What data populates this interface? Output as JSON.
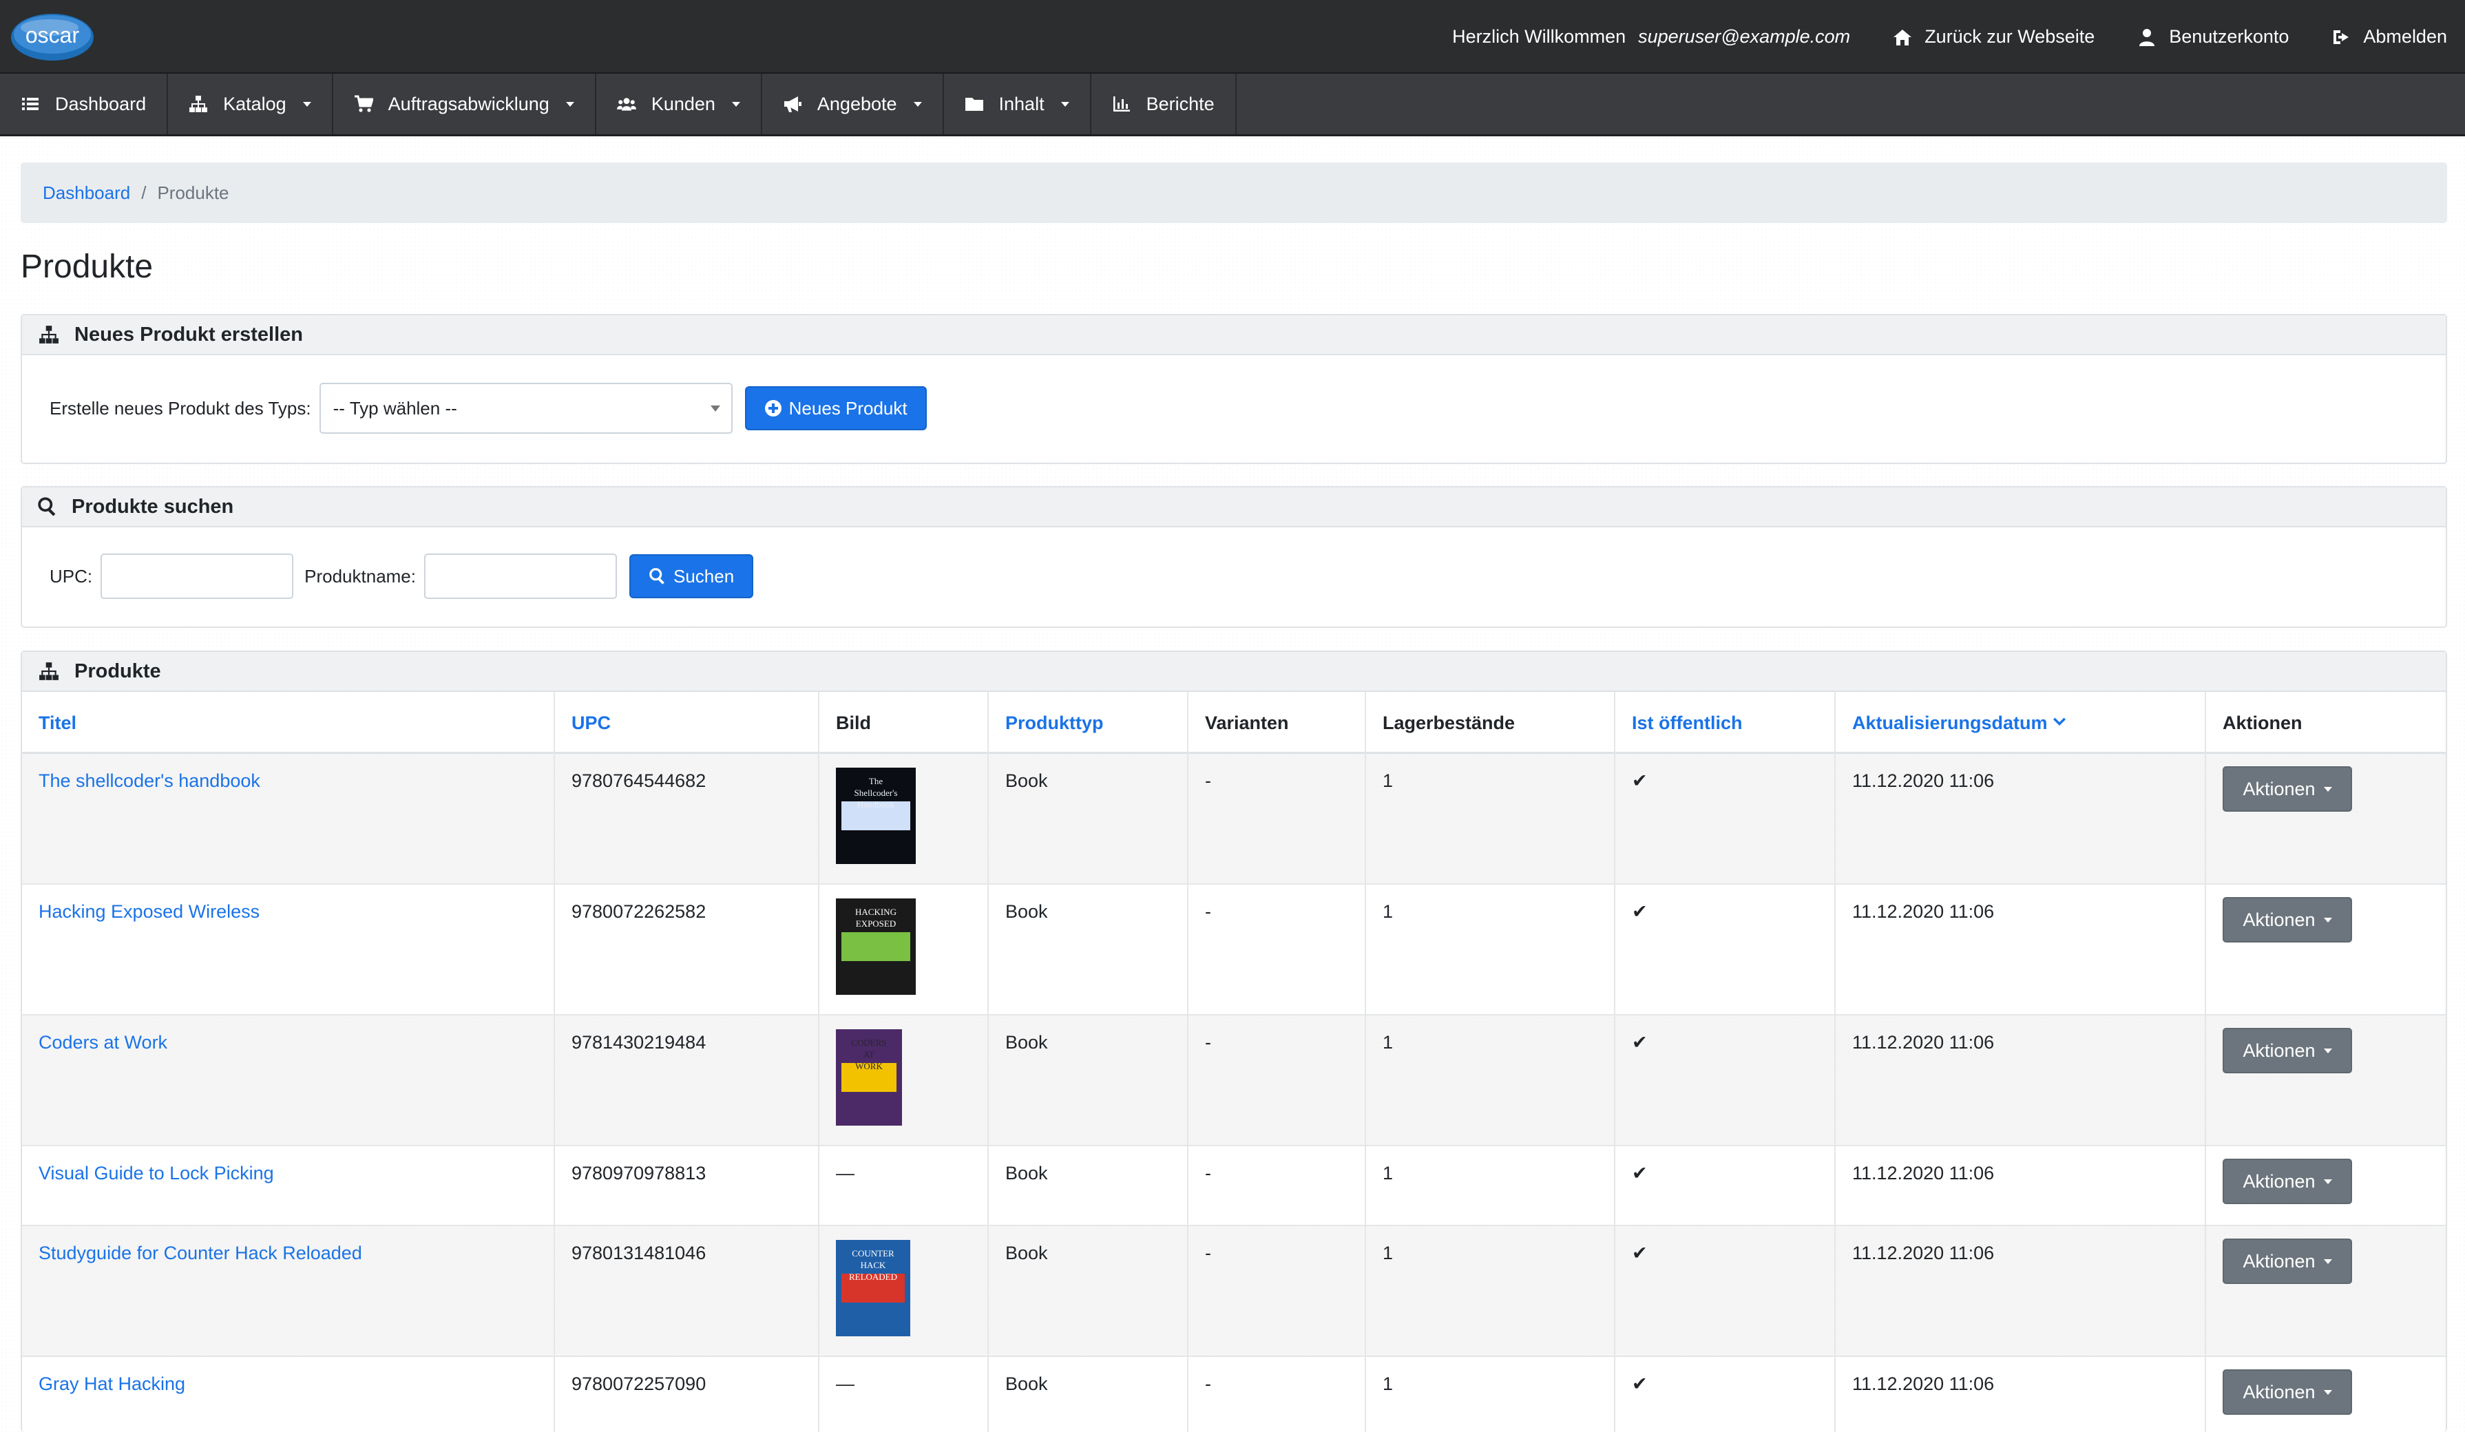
{
  "topbar": {
    "logo_text": "oscar",
    "welcome_prefix": "Herzlich Willkommen",
    "welcome_user": "superuser@example.com",
    "back_label": "Zurück zur Webseite",
    "account_label": "Benutzerkonto",
    "logout_label": "Abmelden"
  },
  "nav": {
    "dashboard": "Dashboard",
    "katalog": "Katalog",
    "auftrag": "Auftragsabwicklung",
    "kunden": "Kunden",
    "angebote": "Angebote",
    "inhalt": "Inhalt",
    "berichte": "Berichte"
  },
  "breadcrumb": {
    "home": "Dashboard",
    "separator": "/",
    "current": "Produkte"
  },
  "page_title": "Produkte",
  "create_panel": {
    "title": "Neues Produkt erstellen",
    "label": "Erstelle neues Produkt des Typs:",
    "select_value": "-- Typ wählen --",
    "button": "Neues Produkt"
  },
  "search_panel": {
    "title": "Produkte suchen",
    "upc_label": "UPC:",
    "name_label": "Produktname:",
    "button": "Suchen"
  },
  "table_panel": {
    "title": "Produkte",
    "headers": {
      "titel": "Titel",
      "upc": "UPC",
      "bild": "Bild",
      "produkttyp": "Produkttyp",
      "varianten": "Varianten",
      "lager": "Lagerbestände",
      "oeffentlich": "Ist öffentlich",
      "datum": "Aktualisierungsdatum",
      "aktionen": "Aktionen"
    },
    "rows": [
      {
        "title": "The shellcoder's handbook",
        "upc": "9780764544682",
        "image": "cover",
        "cover_text": "The Shellcoder's Handbook",
        "type": "Book",
        "variants": "-",
        "stock": "1",
        "public": "✔",
        "updated": "11.12.2020 11:06",
        "action": "Aktionen"
      },
      {
        "title": "Hacking Exposed Wireless",
        "upc": "9780072262582",
        "image": "cover",
        "cover_text": "HACKING EXPOSED",
        "type": "Book",
        "variants": "-",
        "stock": "1",
        "public": "✔",
        "updated": "11.12.2020 11:06",
        "action": "Aktionen"
      },
      {
        "title": "Coders at Work",
        "upc": "9781430219484",
        "image": "cover",
        "cover_text": "CODERS AT WORK",
        "type": "Book",
        "variants": "-",
        "stock": "1",
        "public": "✔",
        "updated": "11.12.2020 11:06",
        "action": "Aktionen"
      },
      {
        "title": "Visual Guide to Lock Picking",
        "upc": "9780970978813",
        "image": "—",
        "type": "Book",
        "variants": "-",
        "stock": "1",
        "public": "✔",
        "updated": "11.12.2020 11:06",
        "action": "Aktionen"
      },
      {
        "title": "Studyguide for Counter Hack Reloaded",
        "upc": "9780131481046",
        "image": "cover",
        "cover_text": "COUNTER HACK RELOADED",
        "type": "Book",
        "variants": "-",
        "stock": "1",
        "public": "✔",
        "updated": "11.12.2020 11:06",
        "action": "Aktionen"
      },
      {
        "title": "Gray Hat Hacking",
        "upc": "9780072257090",
        "image": "—",
        "type": "Book",
        "variants": "-",
        "stock": "1",
        "public": "✔",
        "updated": "11.12.2020 11:06",
        "action": "Aktionen"
      }
    ]
  },
  "colors": {
    "link": "#1a73e8",
    "topbar": "#2b2d2f",
    "navbar": "#3a3c3f",
    "secondary_button": "#6c757d"
  }
}
